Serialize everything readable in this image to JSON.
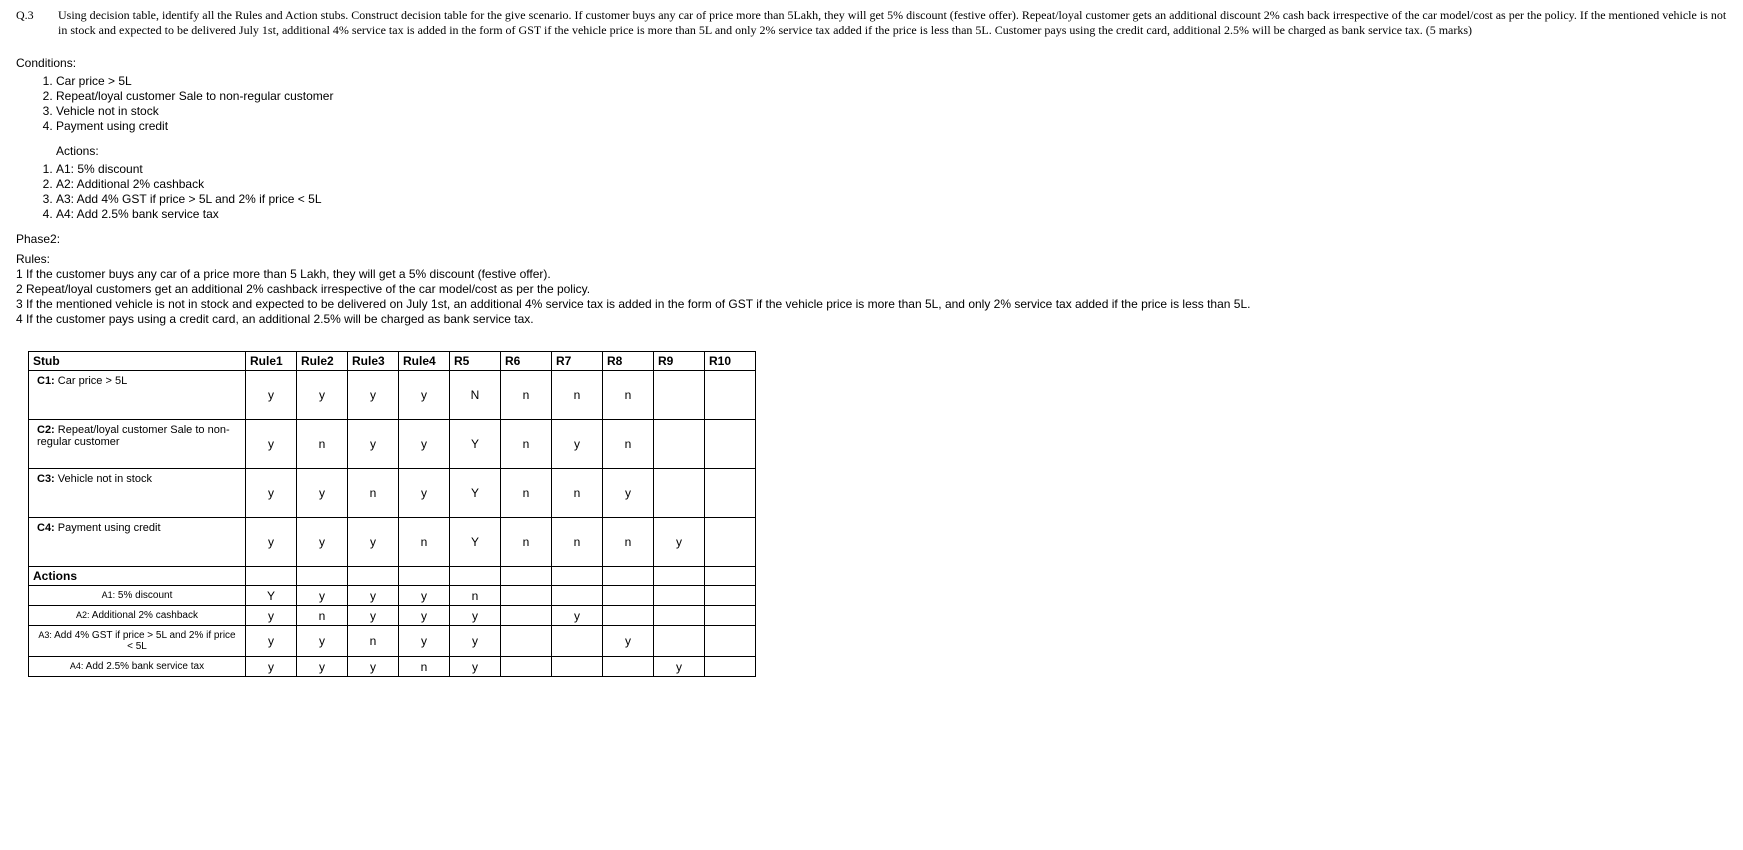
{
  "question": {
    "number": "Q.3",
    "text": "Using decision table, identify all the Rules and Action stubs. Construct decision table for the give scenario. If customer buys any car of price more than 5Lakh, they will get 5% discount (festive offer). Repeat/loyal customer gets an additional discount 2% cash back irrespective of the car model/cost as per the policy. If the mentioned vehicle is not in stock and expected to be delivered July 1st, additional 4% service tax is added in the form of GST if the vehicle price is more than 5L and only 2% service tax added if the price is less than 5L. Customer pays using the credit card, additional 2.5% will be charged as bank service tax. (5 marks)"
  },
  "conditions": {
    "label": "Conditions:",
    "items": [
      "Car price > 5L",
      "Repeat/loyal customer Sale to non-regular customer",
      "Vehicle not in stock",
      "Payment using credit"
    ]
  },
  "actions_list": {
    "label": "Actions:",
    "items": [
      "A1: 5% discount",
      "A2: Additional 2% cashback",
      "A3: Add 4% GST if price > 5L and 2% if price < 5L",
      "A4: Add 2.5% bank service tax"
    ]
  },
  "phase2_label": "Phase2:",
  "rules": {
    "label": "Rules:",
    "items": [
      "1 If the customer buys any car of a price more than 5 Lakh, they will get a 5% discount (festive offer).",
      "2 Repeat/loyal customers get an additional 2% cashback irrespective of the car model/cost as per the policy.",
      "3 If the mentioned vehicle is not in stock and expected to be delivered on July 1st, an additional 4% service tax is added in the form of GST if the vehicle price is more than 5L, and only 2% service tax added if the price is less than 5L.",
      "4 If the customer pays using a credit card, an additional 2.5% will be charged as bank service tax."
    ]
  },
  "table": {
    "headers": [
      "Stub",
      "Rule1",
      "Rule2",
      "Rule3",
      "Rule4",
      "R5",
      "R6",
      "R7",
      "R8",
      "R9",
      "R10"
    ],
    "condition_rows": [
      {
        "stub_prefix": "C1:",
        "stub_text": " Car price > 5L",
        "cells": [
          "y",
          "y",
          "y",
          "y",
          "N",
          "n",
          "n",
          "n",
          "",
          ""
        ]
      },
      {
        "stub_prefix": "C2:",
        "stub_text": " Repeat/loyal customer Sale to non-regular customer",
        "cells": [
          "y",
          "n",
          "y",
          "y",
          "Y",
          "n",
          "y",
          "n",
          "",
          ""
        ]
      },
      {
        "stub_prefix": "C3:",
        "stub_text": " Vehicle not in stock",
        "cells": [
          "y",
          "y",
          "n",
          "y",
          "Y",
          "n",
          "n",
          "y",
          "",
          ""
        ]
      },
      {
        "stub_prefix": "C4:",
        "stub_text": " Payment using credit",
        "cells": [
          "y",
          "y",
          "y",
          "n",
          "Y",
          "n",
          "n",
          "n",
          "y",
          ""
        ]
      }
    ],
    "actions_header": "Actions",
    "action_rows": [
      {
        "stub_prefix": "A1:",
        "stub_text": " 5% discount",
        "cells": [
          "Y",
          "y",
          "y",
          "y",
          "n",
          "",
          "",
          "",
          "",
          ""
        ]
      },
      {
        "stub_prefix": "A2:",
        "stub_text": " Additional 2% cashback",
        "cells": [
          "y",
          "n",
          "y",
          "y",
          "y",
          "",
          "y",
          "",
          "",
          ""
        ]
      },
      {
        "stub_prefix": "A3:",
        "stub_text": " Add 4% GST if price > 5L and 2% if price < 5L",
        "cells": [
          "y",
          "y",
          "n",
          "y",
          "y",
          "",
          "",
          "y",
          "",
          ""
        ]
      },
      {
        "stub_prefix": "A4:",
        "stub_text": " Add 2.5% bank service tax",
        "cells": [
          "y",
          "y",
          "y",
          "n",
          "y",
          "",
          "",
          "",
          "y",
          ""
        ]
      }
    ]
  }
}
